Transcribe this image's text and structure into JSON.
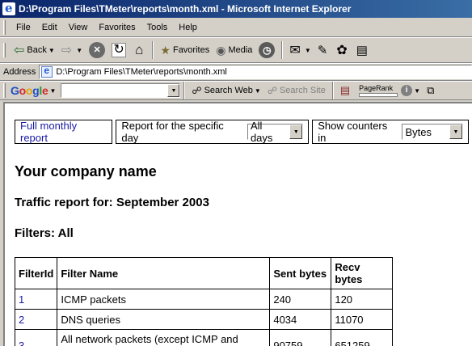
{
  "window": {
    "title": "D:\\Program Files\\TMeter\\reports\\month.xml - Microsoft Internet Explorer"
  },
  "menu": [
    "File",
    "Edit",
    "View",
    "Favorites",
    "Tools",
    "Help"
  ],
  "toolbar": {
    "back_label": "Back",
    "favorites_label": "Favorites",
    "media_label": "Media"
  },
  "address": {
    "label": "Address",
    "value": "D:\\Program Files\\TMeter\\reports\\month.xml"
  },
  "googlebar": {
    "logo": "Google",
    "search_web_label": "Search Web",
    "search_site_label": "Search Site",
    "pagerank_label": "PageRank"
  },
  "report": {
    "full_report_link": "Full monthly report",
    "specific_day_label": "Report for the specific day",
    "specific_day_value": "All days",
    "counters_label": "Show counters in",
    "counters_value": "Bytes",
    "company": "Your company name",
    "traffic_title": "Traffic report for: September 2003",
    "filters_title": "Filters: All",
    "columns": [
      "FilterId",
      "Filter Name",
      "Sent bytes",
      "Recv bytes"
    ],
    "rows": [
      [
        "1",
        "ICMP packets",
        "240",
        "120"
      ],
      [
        "2",
        "DNS queries",
        "4034",
        "11070"
      ],
      [
        "3",
        "All network packets (except ICMP and DNS)",
        "90759",
        "651259"
      ]
    ]
  },
  "colors": {
    "title_gradient_start": "#0a246a",
    "title_gradient_end": "#3a6ea5",
    "chrome": "#d4d0c8",
    "link": "#1a1aa6"
  }
}
